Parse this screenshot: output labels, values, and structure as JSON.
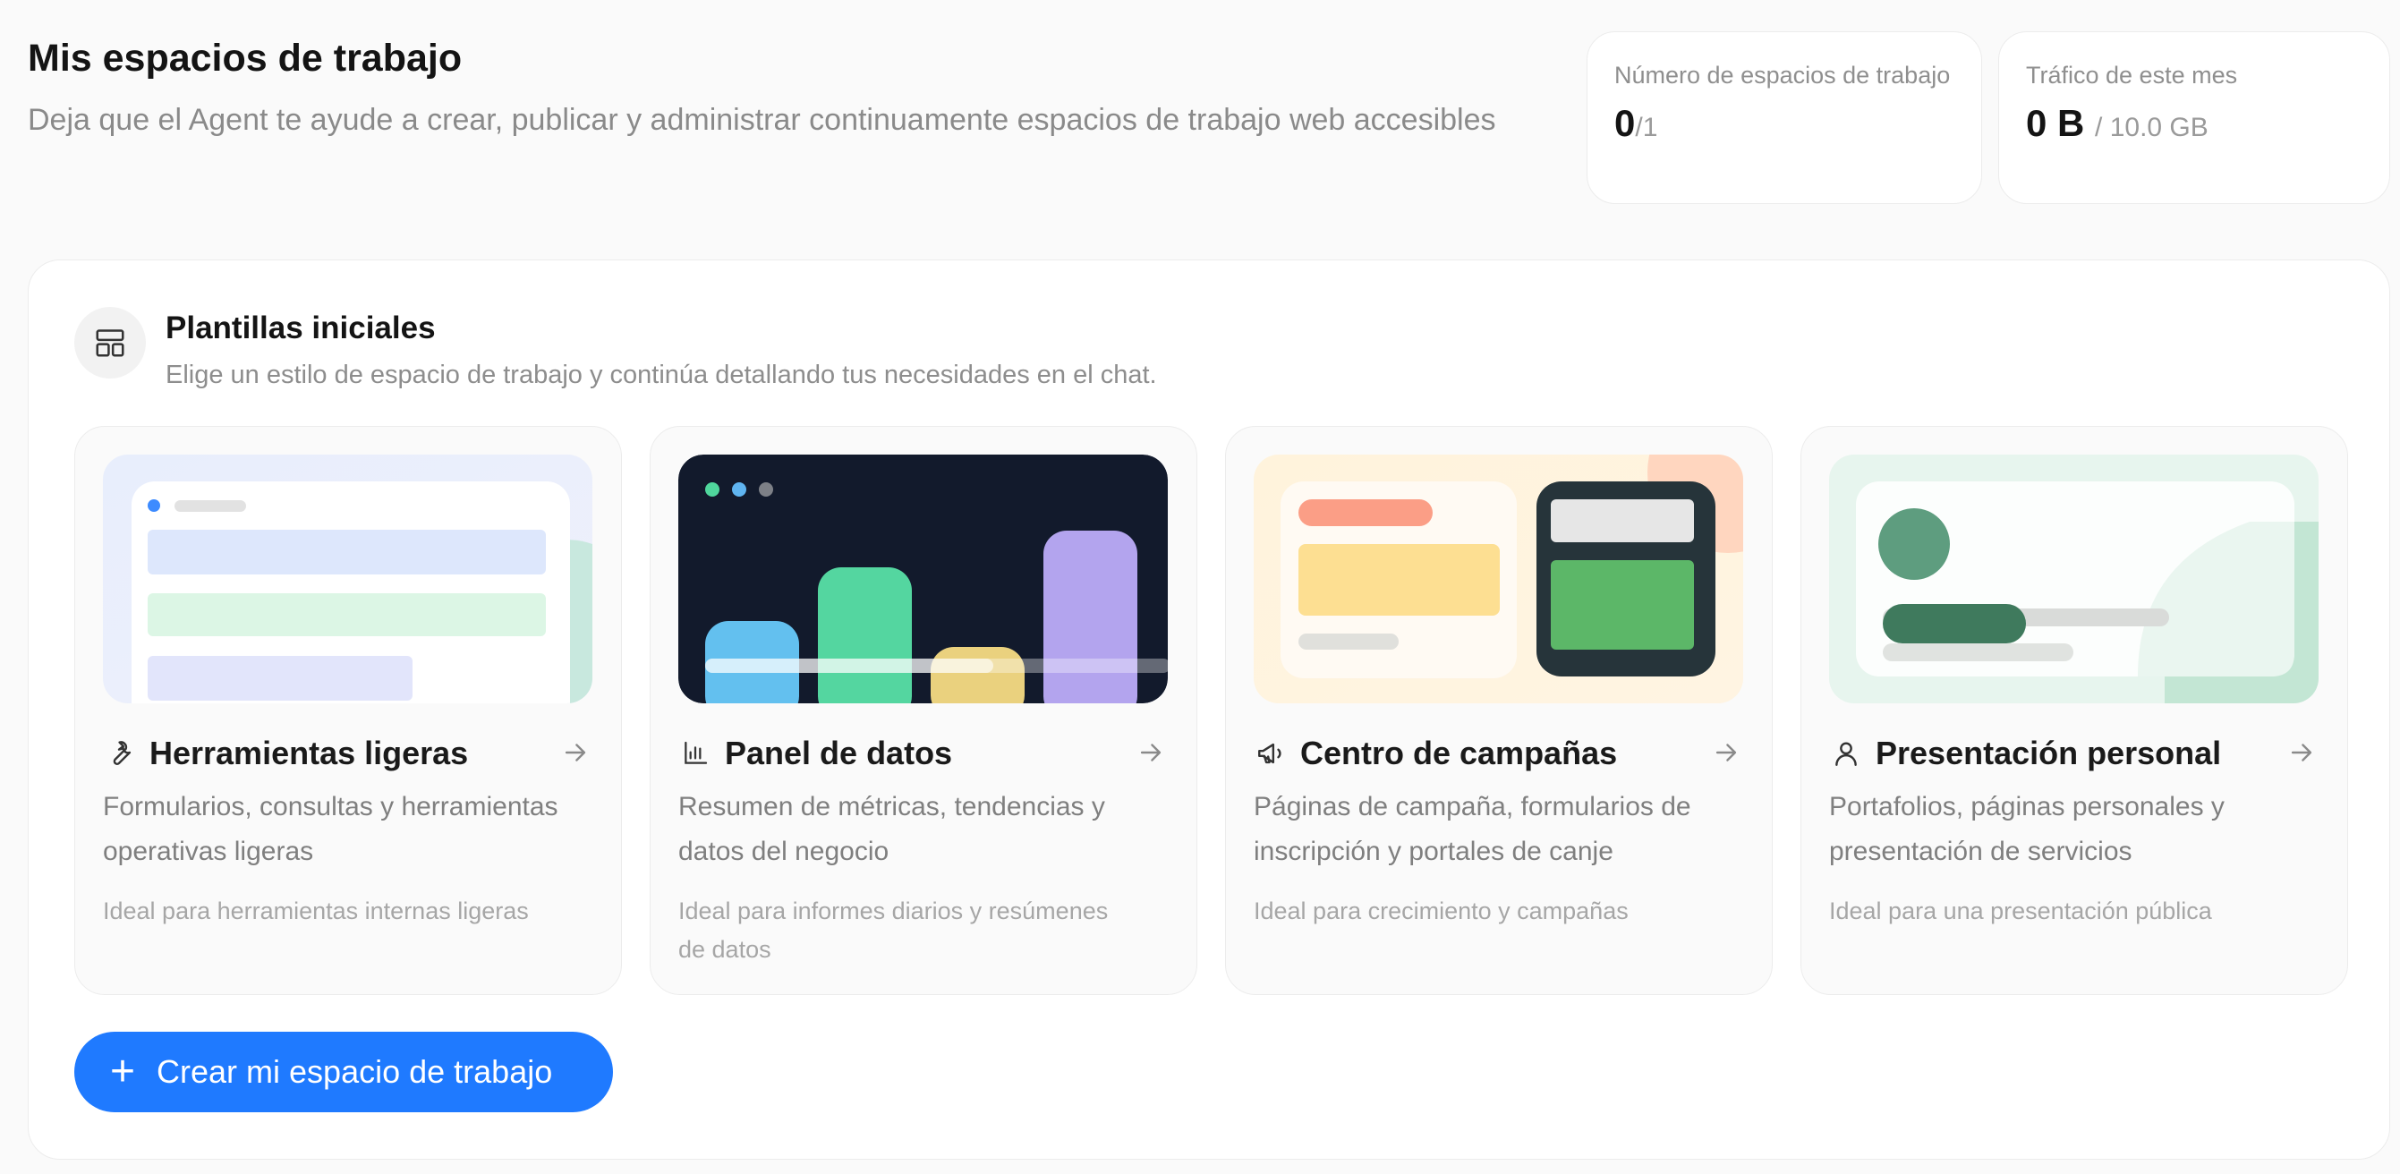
{
  "header": {
    "title": "Mis espacios de trabajo",
    "subtitle": "Deja que el Agent te ayude a crear, publicar y administrar continuamente espacios de trabajo web accesibles"
  },
  "stats": {
    "workspaces": {
      "label": "Número de espacios de trabajo",
      "value": "0",
      "limit": "/1"
    },
    "traffic": {
      "label": "Tráfico de este mes",
      "value": "0 B",
      "limit": "/ 10.0 GB"
    }
  },
  "templates": {
    "title": "Plantillas iniciales",
    "subtitle": "Elige un estilo de espacio de trabajo y continúa detallando tus necesidades en el chat.",
    "icon": "layout-icon",
    "cards": [
      {
        "icon": "wrench-icon",
        "title": "Herramientas ligeras",
        "description": "Formularios, consultas y herramientas operativas ligeras",
        "ideal": "Ideal para herramientas internas ligeras"
      },
      {
        "icon": "bar-chart-icon",
        "title": "Panel de datos",
        "description": "Resumen de métricas, tendencias y datos del negocio",
        "ideal": "Ideal para informes diarios y resúmenes de datos"
      },
      {
        "icon": "megaphone-icon",
        "title": "Centro de campañas",
        "description": "Páginas de campaña, formularios de inscripción y portales de canje",
        "ideal": "Ideal para crecimiento y campañas"
      },
      {
        "icon": "user-icon",
        "title": "Presentación personal",
        "description": "Portafolios, páginas personales y presentación de servicios",
        "ideal": "Ideal para una presentación pública"
      }
    ]
  },
  "actions": {
    "create_label": "Crear mi espacio de trabajo",
    "create_icon": "plus-icon"
  },
  "colors": {
    "accent": "#1f7aff"
  }
}
